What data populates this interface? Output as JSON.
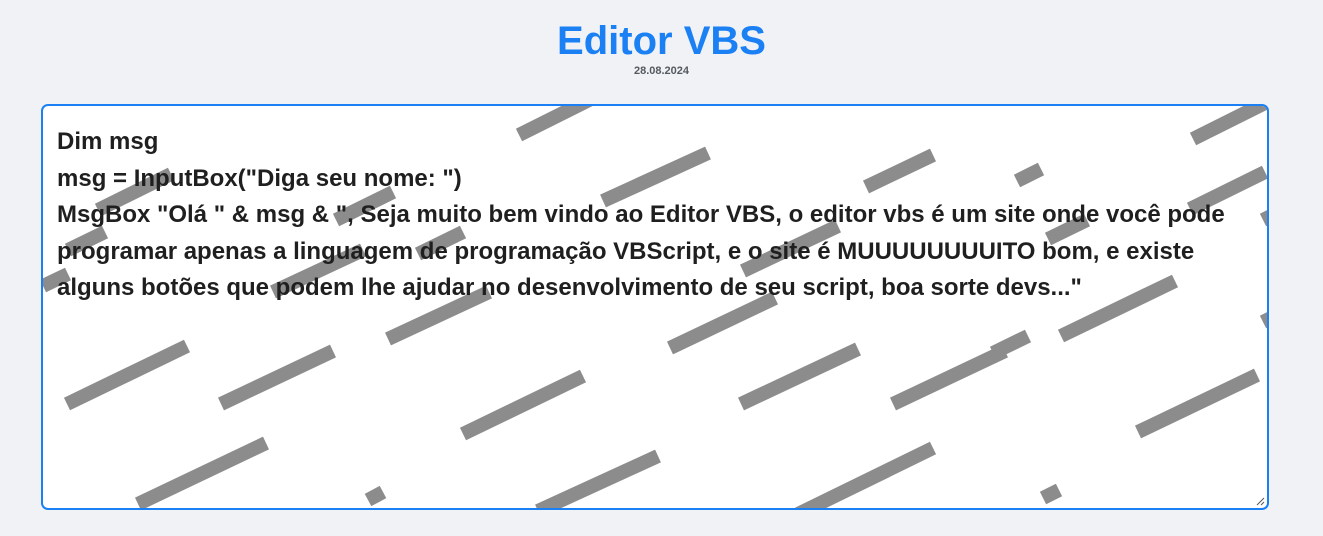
{
  "header": {
    "title": "Editor VBS",
    "date": "28.08.2024"
  },
  "editor": {
    "code": "Dim msg\nmsg = InputBox(\"Diga seu nome: \")\nMsgBox \"Olá \" & msg & \", Seja muito bem vindo ao Editor VBS, o editor vbs é um site onde você pode programar apenas a linguagem de programação VBScript, e o site é MUUUUUUUUITO bom, e existe alguns botões que podem lhe ajudar no desenvolvimento de seu script, boa sorte devs...\""
  },
  "colors": {
    "accent": "#1a80f4",
    "background": "#f0f2f6",
    "stripe": "#8c8c8c",
    "text": "#1f1f1f"
  },
  "icons": {
    "resize": "resize-grip-icon"
  }
}
